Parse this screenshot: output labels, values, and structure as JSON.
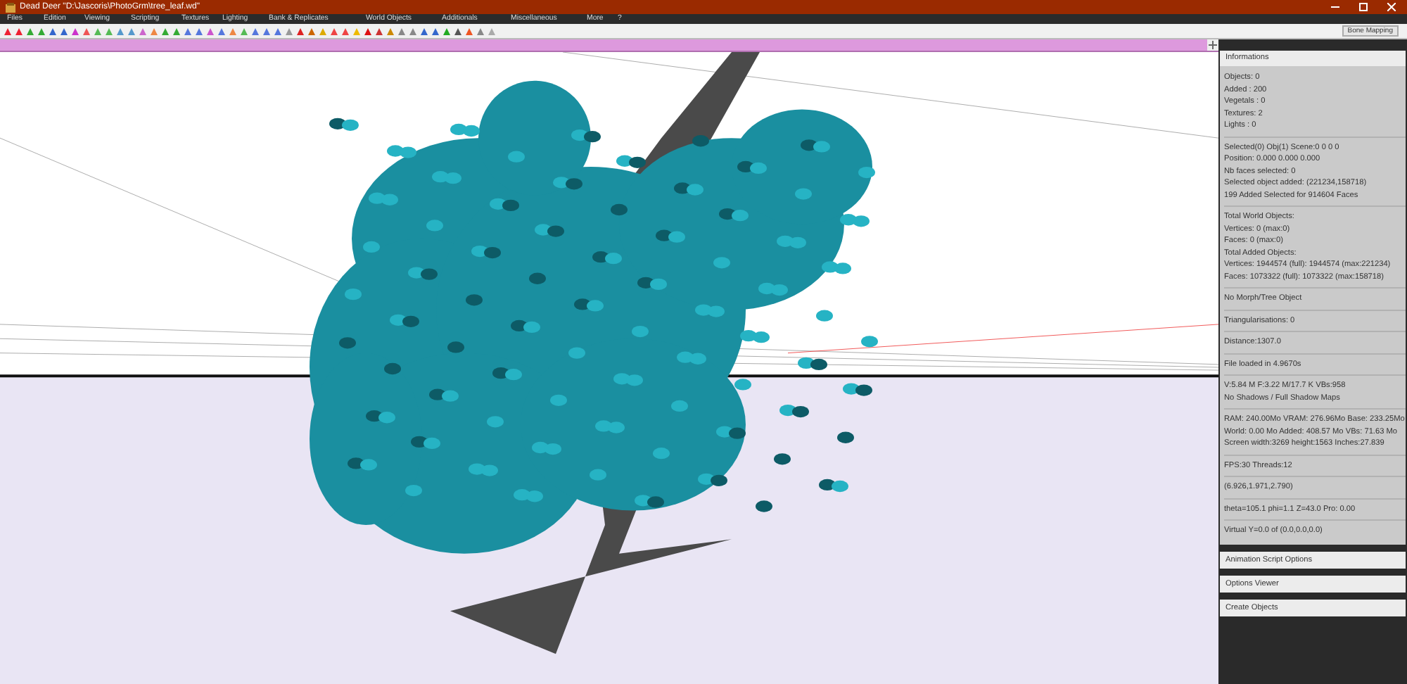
{
  "window": {
    "title": "Dead Deer \"D:\\Jascoris\\PhotoGrm\\tree_leaf.wd\""
  },
  "menu": [
    "Files",
    "Edition",
    "Viewing",
    "Scripting",
    "Textures",
    "Lighting",
    "Bank & Replicates",
    "World Objects",
    "Additionals",
    "Miscellaneous",
    "More",
    "?"
  ],
  "toolbar": {
    "mode_button": "Bone Mapping"
  },
  "info_panel": {
    "title": "Informations",
    "groups": [
      [
        "Objects: 0",
        "Added : 200",
        "Vegetals : 0",
        "Textures: 2",
        "Lights : 0"
      ],
      [
        "Selected(0) Obj(1) Scene:0 0 0 0",
        "Position: 0.000 0.000 0.000",
        "Nb faces selected: 0",
        "Selected object added: (221234,158718)",
        "199 Added Selected for 914604 Faces"
      ],
      [
        "Total World Objects:",
        "Vertices: 0 (max:0)",
        "Faces: 0 (max:0)",
        "Total Added Objects:",
        "Vertices: 1944574 (full): 1944574 (max:221234)",
        "Faces: 1073322 (full): 1073322 (max:158718)"
      ],
      [
        "No Morph/Tree Object"
      ],
      [
        "Triangularisations: 0"
      ],
      [
        "Distance:1307.0"
      ],
      [
        "File loaded in 4.9670s"
      ],
      [
        "V:5.84 M F:3.22 M/17.7 K VBs:958",
        "No Shadows / Full Shadow Maps"
      ],
      [
        "RAM: 240.00Mo VRAM: 276.96Mo Base: 233.25Mo",
        "World: 0.00 Mo Added: 408.57 Mo VBs: 71.63 Mo",
        "Screen width:3269 height:1563 Inches:27.839"
      ],
      [
        "FPS:30 Threads:12"
      ],
      [
        "(6.926,1.971,2.790)"
      ],
      [
        "theta=105.1 phi=1.1 Z=43.0 Pro: 0.00"
      ],
      [
        "Virtual Y=0.0 of (0.0,0.0,0.0)"
      ]
    ]
  },
  "collapsed_panels": [
    "Animation Script Options",
    "Options Viewer",
    "Create Objects"
  ]
}
